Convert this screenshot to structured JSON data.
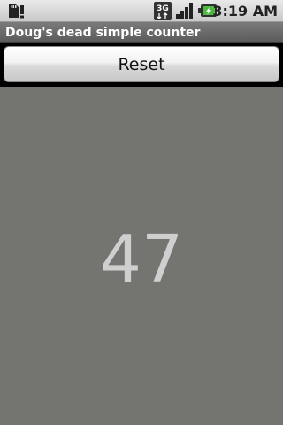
{
  "status_bar": {
    "left_icon": "sd-card-warning-icon",
    "network_label": "3G",
    "network_icon": "3g-data-icon",
    "signal_icon": "signal-strength-icon",
    "battery_icon": "battery-charging-icon",
    "time": "3:19 AM"
  },
  "app": {
    "title": "Doug's dead simple counter"
  },
  "actions": {
    "reset_label": "Reset"
  },
  "counter": {
    "value": "47"
  },
  "colors": {
    "counter_background": "#747571",
    "counter_text": "#cfcfcf",
    "title_bar": "#6a6a6a"
  }
}
